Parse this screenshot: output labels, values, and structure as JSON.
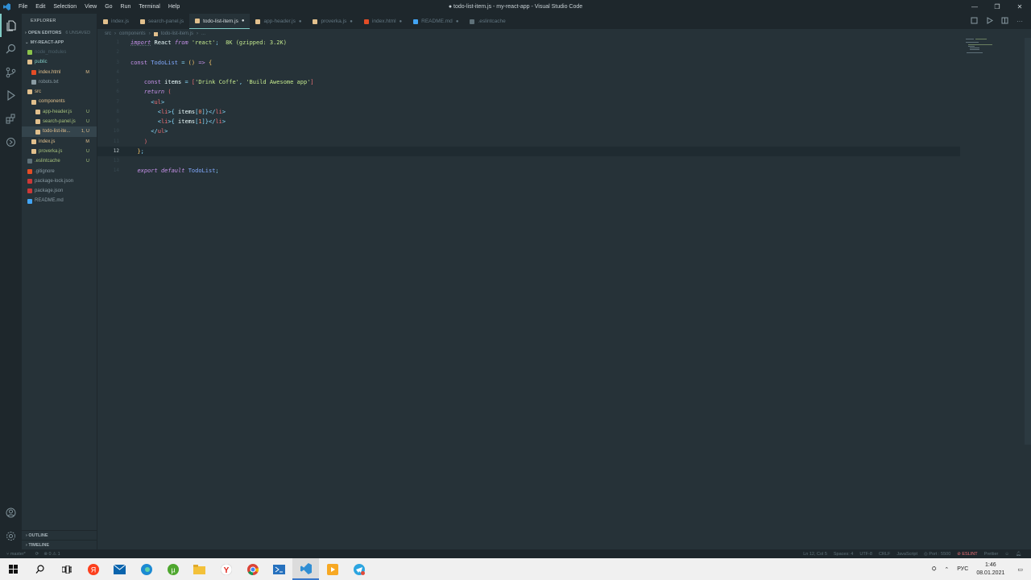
{
  "window": {
    "title": "● todo-list-item.js - my-react-app - Visual Studio Code",
    "menu": [
      "File",
      "Edit",
      "Selection",
      "View",
      "Go",
      "Run",
      "Terminal",
      "Help"
    ]
  },
  "sidebar": {
    "title": "EXPLORER",
    "open_editors": "OPEN EDITORS",
    "open_editors_badge": "6 UNSAVED",
    "project": "MY-REACT-APP",
    "tree": [
      {
        "label": "node_modules",
        "indent": 1,
        "type": "folder-special",
        "status": "",
        "color": "#4b5f69"
      },
      {
        "label": "public",
        "indent": 1,
        "type": "folder",
        "status": "",
        "color": "#80cbc4"
      },
      {
        "label": "index.html",
        "indent": 2,
        "type": "html",
        "status": "M",
        "color": "#e2c08d"
      },
      {
        "label": "robots.txt",
        "indent": 2,
        "type": "txt",
        "status": "",
        "color": "#8a9ba3"
      },
      {
        "label": "src",
        "indent": 1,
        "type": "folder",
        "status": "",
        "color": "#e2c08d"
      },
      {
        "label": "components",
        "indent": 2,
        "type": "folder",
        "status": "",
        "color": "#e2c08d"
      },
      {
        "label": "app-header.js",
        "indent": 3,
        "type": "js",
        "status": "U",
        "color": "#a6c17c"
      },
      {
        "label": "search-panel.js",
        "indent": 3,
        "type": "js",
        "status": "U",
        "color": "#a6c17c"
      },
      {
        "label": "todo-list-ite...",
        "indent": 3,
        "type": "js",
        "status": "1, U",
        "color": "#e2c08d",
        "selected": true
      },
      {
        "label": "index.js",
        "indent": 2,
        "type": "js",
        "status": "M",
        "color": "#e2c08d"
      },
      {
        "label": "proverka.js",
        "indent": 2,
        "type": "js",
        "status": "U",
        "color": "#a6c17c"
      },
      {
        "label": ".eslintcache",
        "indent": 1,
        "type": "file",
        "status": "U",
        "color": "#a6c17c"
      },
      {
        "label": ".gitignore",
        "indent": 1,
        "type": "git",
        "status": "",
        "color": "#8a9ba3"
      },
      {
        "label": "package-lock.json",
        "indent": 1,
        "type": "npm",
        "status": "",
        "color": "#8a9ba3"
      },
      {
        "label": "package.json",
        "indent": 1,
        "type": "npm",
        "status": "",
        "color": "#8a9ba3"
      },
      {
        "label": "README.md",
        "indent": 1,
        "type": "info",
        "status": "",
        "color": "#8a9ba3"
      }
    ],
    "outline": "OUTLINE",
    "timeline": "TIMELINE"
  },
  "tabs": [
    {
      "label": "index.js",
      "active": false,
      "dirty": false
    },
    {
      "label": "search-panel.js",
      "active": false,
      "dirty": false
    },
    {
      "label": "todo-list-item.js",
      "active": true,
      "dirty": true
    },
    {
      "label": "app-header.js",
      "active": false,
      "dirty": true
    },
    {
      "label": "proverka.js",
      "active": false,
      "dirty": true
    },
    {
      "label": "index.html",
      "active": false,
      "dirty": true
    },
    {
      "label": "README.md",
      "active": false,
      "dirty": true
    },
    {
      "label": ".eslintcache",
      "active": false,
      "dirty": false
    }
  ],
  "breadcrumb": [
    "src",
    "components",
    "todo-list-item.js"
  ],
  "editor": {
    "current_line": 12,
    "import_size_hint": "8K (gzipped: 3.2K)"
  },
  "statusbar": {
    "branch": "master*",
    "problems": "⊗ 0 ⚠ 1",
    "cursor": "Ln 12, Col 5",
    "spaces": "Spaces: 4",
    "encoding": "UTF-8",
    "eol": "CRLF",
    "language": "JavaScript",
    "port": "◎ Port : 5500",
    "eslint": "⊘ ESLINT",
    "prettier": "Prettier"
  },
  "taskbar": {
    "lang": "РУС",
    "time": "1:46",
    "date": "08.01.2021",
    "icons": [
      "start-icon",
      "search-icon",
      "task-view-icon",
      "yandex-icon",
      "mail-icon",
      "edge-icon",
      "utorrent-icon",
      "file-explorer-icon",
      "yandex-browser-icon",
      "chrome-icon",
      "powershell-icon",
      "vscode-icon",
      "media-player-icon",
      "telegram-icon"
    ]
  }
}
